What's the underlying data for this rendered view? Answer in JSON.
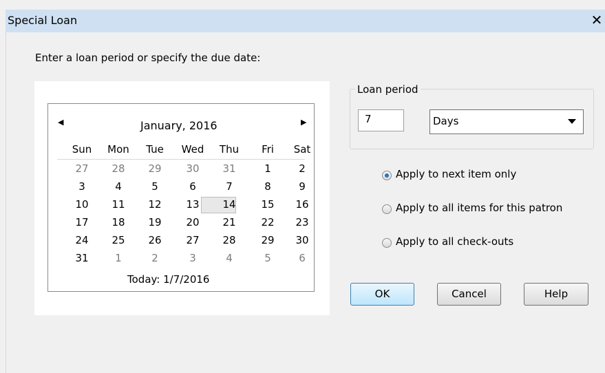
{
  "window": {
    "title": "Special Loan",
    "close_glyph": "✕"
  },
  "prompt": "Enter a loan period or specify the due date:",
  "calendar": {
    "month_label": "January, 2016",
    "prev_glyph": "◀",
    "next_glyph": "▶",
    "weekdays": [
      "Sun",
      "Mon",
      "Tue",
      "Wed",
      "Thu",
      "Fri",
      "Sat"
    ],
    "weeks": [
      [
        "27",
        "28",
        "29",
        "30",
        "31",
        "1",
        "2"
      ],
      [
        "3",
        "4",
        "5",
        "6",
        "7",
        "8",
        "9"
      ],
      [
        "10",
        "11",
        "12",
        "13",
        "14",
        "15",
        "16"
      ],
      [
        "17",
        "18",
        "19",
        "20",
        "21",
        "22",
        "23"
      ],
      [
        "24",
        "25",
        "26",
        "27",
        "28",
        "29",
        "30"
      ],
      [
        "31",
        "1",
        "2",
        "3",
        "4",
        "5",
        "6"
      ]
    ],
    "selected_day": "14",
    "today_label": "Today: 1/7/2016"
  },
  "loan_period": {
    "label": "Loan period",
    "value": "7",
    "unit": "Days"
  },
  "options": [
    {
      "label": "Apply to next item only",
      "checked": true
    },
    {
      "label": "Apply to all items for this patron",
      "checked": false
    },
    {
      "label": "Apply to all check-outs",
      "checked": false
    }
  ],
  "buttons": {
    "ok": "OK",
    "cancel": "Cancel",
    "help": "Help"
  }
}
